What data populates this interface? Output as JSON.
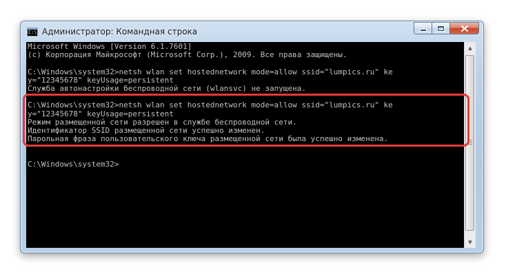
{
  "window": {
    "title": "Администратор: Командная строка",
    "icon_text": "C:\\"
  },
  "caption_buttons": {
    "minimize": "minimize-icon",
    "maximize": "maximize-icon",
    "close": "x"
  },
  "console": {
    "lines": [
      "Microsoft Windows [Version 6.1.7601]",
      "(c) Корпорация Майкрософт (Microsoft Corp.), 2009. Все права защищены.",
      "",
      "C:\\Windows\\system32>netsh wlan set hostednetwork mode=allow ssid=\"lumpics.ru\" ke",
      "y=\"12345678\" keyUsage=persistent",
      "Служба автонастройки беспроводной сети (wlansvc) не запущена.",
      "",
      "C:\\Windows\\system32>netsh wlan set hostednetwork mode=allow ssid=\"lumpics.ru\" ke",
      "y=\"12345678\" keyUsage=persistent",
      "Режим размещенной сети разрешен в службе беспроводной сети.",
      "Идентификатор SSID размещенной сети успешно изменен.",
      "Парольная фраза пользовательского ключа размещенной сети была успешно изменена.",
      "",
      "",
      "C:\\Windows\\system32>"
    ]
  },
  "scrollbar": {
    "up_arrow": "▲",
    "down_arrow": "▼"
  },
  "colors": {
    "console_bg": "#000000",
    "console_text": "#c0c0c0",
    "highlight": "#e53a3a",
    "close_button": "#c7472b"
  }
}
